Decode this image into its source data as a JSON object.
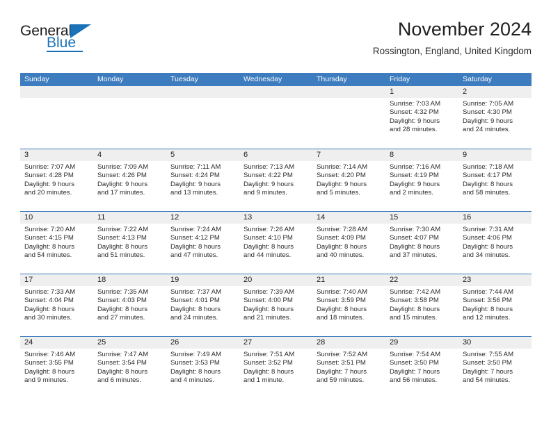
{
  "brand": {
    "name_top": "General",
    "name_bottom": "Blue",
    "accent_color": "#1a72b8"
  },
  "header": {
    "title": "November 2024",
    "subtitle": "Rossington, England, United Kingdom"
  },
  "theme": {
    "header_row_bg": "#3d7cbe",
    "day_band_bg": "#efefef",
    "text_color": "#2a2a2a"
  },
  "calendar": {
    "weekday_headers": [
      "Sunday",
      "Monday",
      "Tuesday",
      "Wednesday",
      "Thursday",
      "Friday",
      "Saturday"
    ],
    "weeks": [
      [
        {
          "day": "",
          "empty": true
        },
        {
          "day": "",
          "empty": true
        },
        {
          "day": "",
          "empty": true
        },
        {
          "day": "",
          "empty": true
        },
        {
          "day": "",
          "empty": true
        },
        {
          "day": "1",
          "sunrise": "Sunrise: 7:03 AM",
          "sunset": "Sunset: 4:32 PM",
          "daylight1": "Daylight: 9 hours",
          "daylight2": "and 28 minutes."
        },
        {
          "day": "2",
          "sunrise": "Sunrise: 7:05 AM",
          "sunset": "Sunset: 4:30 PM",
          "daylight1": "Daylight: 9 hours",
          "daylight2": "and 24 minutes."
        }
      ],
      [
        {
          "day": "3",
          "sunrise": "Sunrise: 7:07 AM",
          "sunset": "Sunset: 4:28 PM",
          "daylight1": "Daylight: 9 hours",
          "daylight2": "and 20 minutes."
        },
        {
          "day": "4",
          "sunrise": "Sunrise: 7:09 AM",
          "sunset": "Sunset: 4:26 PM",
          "daylight1": "Daylight: 9 hours",
          "daylight2": "and 17 minutes."
        },
        {
          "day": "5",
          "sunrise": "Sunrise: 7:11 AM",
          "sunset": "Sunset: 4:24 PM",
          "daylight1": "Daylight: 9 hours",
          "daylight2": "and 13 minutes."
        },
        {
          "day": "6",
          "sunrise": "Sunrise: 7:13 AM",
          "sunset": "Sunset: 4:22 PM",
          "daylight1": "Daylight: 9 hours",
          "daylight2": "and 9 minutes."
        },
        {
          "day": "7",
          "sunrise": "Sunrise: 7:14 AM",
          "sunset": "Sunset: 4:20 PM",
          "daylight1": "Daylight: 9 hours",
          "daylight2": "and 5 minutes."
        },
        {
          "day": "8",
          "sunrise": "Sunrise: 7:16 AM",
          "sunset": "Sunset: 4:19 PM",
          "daylight1": "Daylight: 9 hours",
          "daylight2": "and 2 minutes."
        },
        {
          "day": "9",
          "sunrise": "Sunrise: 7:18 AM",
          "sunset": "Sunset: 4:17 PM",
          "daylight1": "Daylight: 8 hours",
          "daylight2": "and 58 minutes."
        }
      ],
      [
        {
          "day": "10",
          "sunrise": "Sunrise: 7:20 AM",
          "sunset": "Sunset: 4:15 PM",
          "daylight1": "Daylight: 8 hours",
          "daylight2": "and 54 minutes."
        },
        {
          "day": "11",
          "sunrise": "Sunrise: 7:22 AM",
          "sunset": "Sunset: 4:13 PM",
          "daylight1": "Daylight: 8 hours",
          "daylight2": "and 51 minutes."
        },
        {
          "day": "12",
          "sunrise": "Sunrise: 7:24 AM",
          "sunset": "Sunset: 4:12 PM",
          "daylight1": "Daylight: 8 hours",
          "daylight2": "and 47 minutes."
        },
        {
          "day": "13",
          "sunrise": "Sunrise: 7:26 AM",
          "sunset": "Sunset: 4:10 PM",
          "daylight1": "Daylight: 8 hours",
          "daylight2": "and 44 minutes."
        },
        {
          "day": "14",
          "sunrise": "Sunrise: 7:28 AM",
          "sunset": "Sunset: 4:09 PM",
          "daylight1": "Daylight: 8 hours",
          "daylight2": "and 40 minutes."
        },
        {
          "day": "15",
          "sunrise": "Sunrise: 7:30 AM",
          "sunset": "Sunset: 4:07 PM",
          "daylight1": "Daylight: 8 hours",
          "daylight2": "and 37 minutes."
        },
        {
          "day": "16",
          "sunrise": "Sunrise: 7:31 AM",
          "sunset": "Sunset: 4:06 PM",
          "daylight1": "Daylight: 8 hours",
          "daylight2": "and 34 minutes."
        }
      ],
      [
        {
          "day": "17",
          "sunrise": "Sunrise: 7:33 AM",
          "sunset": "Sunset: 4:04 PM",
          "daylight1": "Daylight: 8 hours",
          "daylight2": "and 30 minutes."
        },
        {
          "day": "18",
          "sunrise": "Sunrise: 7:35 AM",
          "sunset": "Sunset: 4:03 PM",
          "daylight1": "Daylight: 8 hours",
          "daylight2": "and 27 minutes."
        },
        {
          "day": "19",
          "sunrise": "Sunrise: 7:37 AM",
          "sunset": "Sunset: 4:01 PM",
          "daylight1": "Daylight: 8 hours",
          "daylight2": "and 24 minutes."
        },
        {
          "day": "20",
          "sunrise": "Sunrise: 7:39 AM",
          "sunset": "Sunset: 4:00 PM",
          "daylight1": "Daylight: 8 hours",
          "daylight2": "and 21 minutes."
        },
        {
          "day": "21",
          "sunrise": "Sunrise: 7:40 AM",
          "sunset": "Sunset: 3:59 PM",
          "daylight1": "Daylight: 8 hours",
          "daylight2": "and 18 minutes."
        },
        {
          "day": "22",
          "sunrise": "Sunrise: 7:42 AM",
          "sunset": "Sunset: 3:58 PM",
          "daylight1": "Daylight: 8 hours",
          "daylight2": "and 15 minutes."
        },
        {
          "day": "23",
          "sunrise": "Sunrise: 7:44 AM",
          "sunset": "Sunset: 3:56 PM",
          "daylight1": "Daylight: 8 hours",
          "daylight2": "and 12 minutes."
        }
      ],
      [
        {
          "day": "24",
          "sunrise": "Sunrise: 7:46 AM",
          "sunset": "Sunset: 3:55 PM",
          "daylight1": "Daylight: 8 hours",
          "daylight2": "and 9 minutes."
        },
        {
          "day": "25",
          "sunrise": "Sunrise: 7:47 AM",
          "sunset": "Sunset: 3:54 PM",
          "daylight1": "Daylight: 8 hours",
          "daylight2": "and 6 minutes."
        },
        {
          "day": "26",
          "sunrise": "Sunrise: 7:49 AM",
          "sunset": "Sunset: 3:53 PM",
          "daylight1": "Daylight: 8 hours",
          "daylight2": "and 4 minutes."
        },
        {
          "day": "27",
          "sunrise": "Sunrise: 7:51 AM",
          "sunset": "Sunset: 3:52 PM",
          "daylight1": "Daylight: 8 hours",
          "daylight2": "and 1 minute."
        },
        {
          "day": "28",
          "sunrise": "Sunrise: 7:52 AM",
          "sunset": "Sunset: 3:51 PM",
          "daylight1": "Daylight: 7 hours",
          "daylight2": "and 59 minutes."
        },
        {
          "day": "29",
          "sunrise": "Sunrise: 7:54 AM",
          "sunset": "Sunset: 3:50 PM",
          "daylight1": "Daylight: 7 hours",
          "daylight2": "and 56 minutes."
        },
        {
          "day": "30",
          "sunrise": "Sunrise: 7:55 AM",
          "sunset": "Sunset: 3:50 PM",
          "daylight1": "Daylight: 7 hours",
          "daylight2": "and 54 minutes."
        }
      ]
    ]
  }
}
